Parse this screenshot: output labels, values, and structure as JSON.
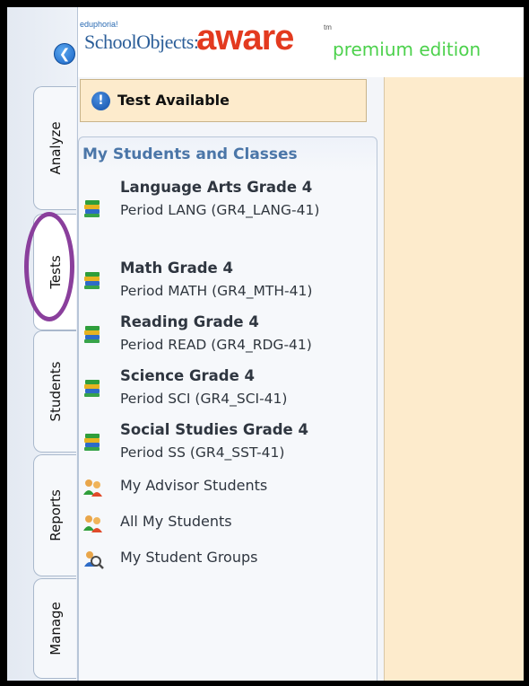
{
  "header": {
    "logo_super": "eduphoria!",
    "logo_school": "SchoolObjects:",
    "logo_aware": "aware",
    "logo_tm": "tm",
    "edition": "premium edition"
  },
  "tabs": [
    {
      "label": "Analyze"
    },
    {
      "label": "Tests"
    },
    {
      "label": "Students"
    },
    {
      "label": "Reports"
    },
    {
      "label": "Manage"
    }
  ],
  "banner": {
    "text": "Test Available"
  },
  "list": {
    "title": "My Students and Classes",
    "classes": [
      {
        "name": "Language Arts Grade 4",
        "period": "Period LANG (GR4_LANG-41)"
      },
      {
        "name": "Math Grade 4",
        "period": "Period MATH (GR4_MTH-41)"
      },
      {
        "name": "Reading Grade 4",
        "period": "Period READ (GR4_RDG-41)"
      },
      {
        "name": "Science Grade 4",
        "period": "Period SCI (GR4_SCI-41)"
      },
      {
        "name": "Social Studies Grade 4",
        "period": "Period SS (GR4_SST-41)"
      }
    ],
    "groups": [
      {
        "label": "My Advisor Students",
        "icon": "advisor-students-icon"
      },
      {
        "label": "All My Students",
        "icon": "all-students-icon"
      },
      {
        "label": "My Student Groups",
        "icon": "student-groups-icon"
      }
    ]
  },
  "colors": {
    "highlight": "#8a3f9c",
    "aware_red": "#e33a1f",
    "edition_green": "#4cd14c",
    "banner_bg": "#fdebcc",
    "title_blue": "#4b76a8"
  }
}
